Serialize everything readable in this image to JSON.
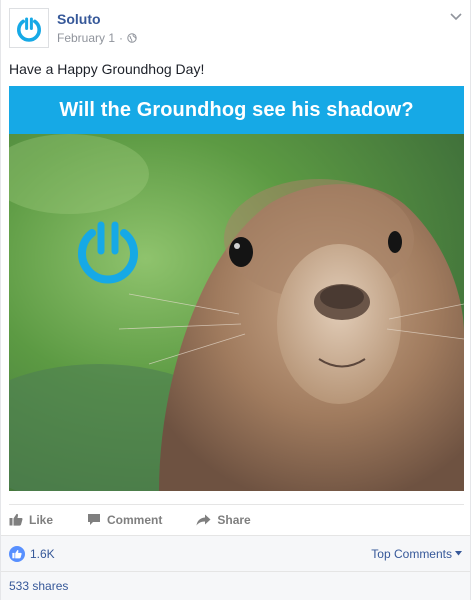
{
  "post": {
    "page_name": "Soluto",
    "date": "February 1",
    "date_separator": "·",
    "message": "Have a Happy Groundhog Day!",
    "image_banner_text": "Will the Groundhog see his shadow?"
  },
  "actions": {
    "like_label": "Like",
    "comment_label": "Comment",
    "share_label": "Share"
  },
  "reactions": {
    "like_count": "1.6K",
    "top_comments_label": "Top Comments"
  },
  "shares": {
    "label": "533 shares"
  },
  "colors": {
    "brand_blue": "#16a9e6",
    "facebook_link": "#365899",
    "like_badge": "#5890ff"
  }
}
